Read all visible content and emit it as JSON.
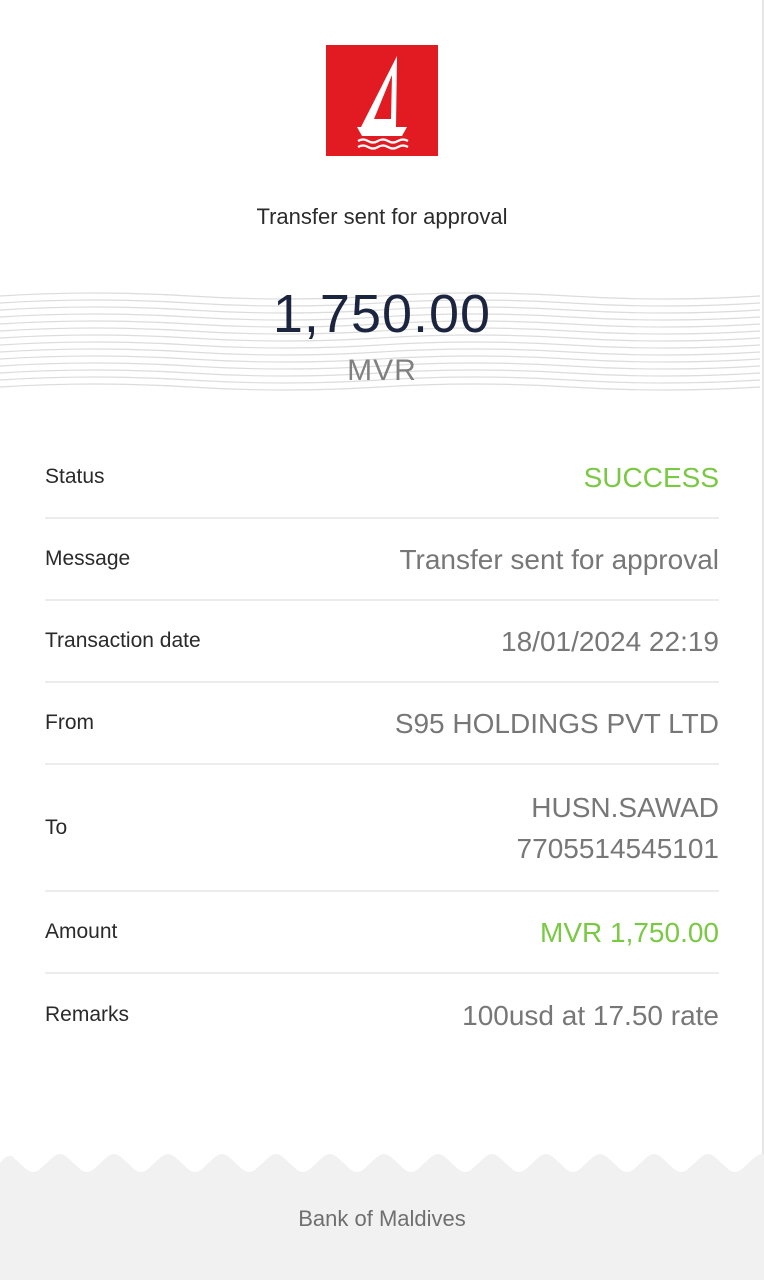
{
  "header": {
    "logo": "bank-of-maldives-boat-logo",
    "headline": "Transfer sent for approval"
  },
  "amount": {
    "value": "1,750.00",
    "currency": "MVR"
  },
  "details": {
    "status_label": "Status",
    "status_value": "SUCCESS",
    "message_label": "Message",
    "message_value": "Transfer sent for approval",
    "date_label": "Transaction date",
    "date_value": "18/01/2024 22:19",
    "from_label": "From",
    "from_value": "S95 HOLDINGS PVT LTD",
    "to_label": "To",
    "to_name": "HUSN.SAWAD",
    "to_account": "7705514545101",
    "amount_label": "Amount",
    "amount_value": "MVR 1,750.00",
    "remarks_label": "Remarks",
    "remarks_value": "100usd at 17.50 rate"
  },
  "footer": {
    "bank_name": "Bank of Maldives"
  },
  "colors": {
    "brand_red": "#e21b23",
    "success_green": "#7ac943",
    "amount_navy": "#1b2540"
  }
}
